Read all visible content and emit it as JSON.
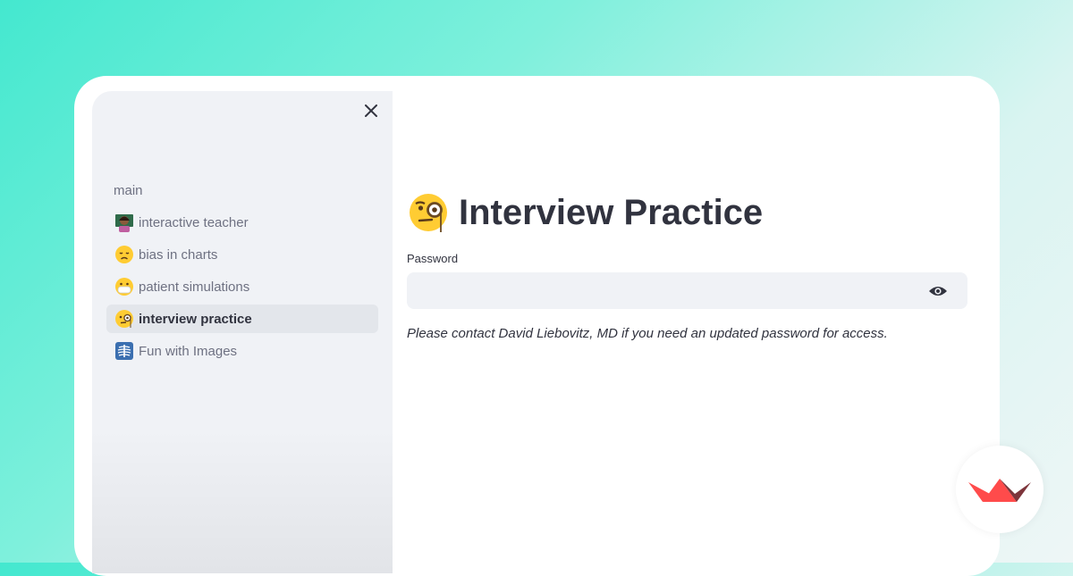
{
  "sidebar": {
    "close_icon": "close-icon",
    "items": [
      {
        "label": "main",
        "emoji": null
      },
      {
        "label": "interactive teacher",
        "emoji": "teacher-emoji"
      },
      {
        "label": "bias in charts",
        "emoji": "disappointed-face-emoji"
      },
      {
        "label": "patient simulations",
        "emoji": "mask-face-emoji"
      },
      {
        "label": "interview practice",
        "emoji": "monocle-face-emoji",
        "active": true
      },
      {
        "label": "Fun with Images",
        "emoji": "xray-emoji"
      }
    ]
  },
  "main": {
    "title": "Interview Practice",
    "title_emoji": "monocle-face-emoji",
    "password_label": "Password",
    "password_value": "",
    "note": "Please contact David Liebovitz, MD if you need an updated password for access."
  },
  "colors": {
    "accent_red": "#ff4b4b",
    "text": "#31333f",
    "muted_text": "#6e7182",
    "sidebar_bg": "#f0f2f6"
  },
  "branding": {
    "logo": "streamlit-logo"
  }
}
